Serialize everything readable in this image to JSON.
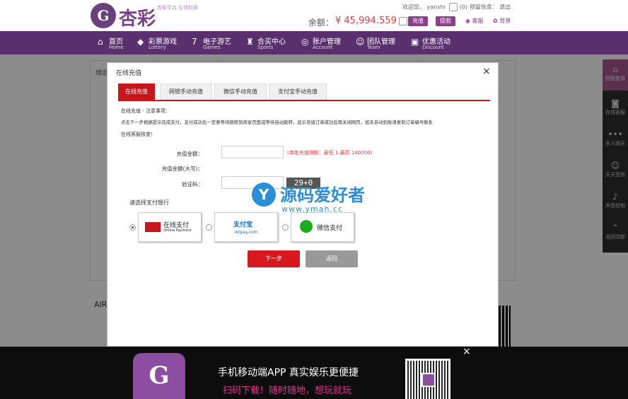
{
  "header": {
    "logo_letter": "G",
    "logo_text": "杏彩",
    "slogan": "杏彩平台 引领时尚",
    "welcome": "欢迎您，",
    "username": "yanshi",
    "msg_count": "(0)",
    "notice_label": "预留信息：",
    "logout": "退出",
    "balance_label": "余额：",
    "balance": "¥ 45,994.559",
    "recharge_btn": "充值",
    "withdraw_btn": "提款",
    "service_link": "客服",
    "skin_link": "背景"
  },
  "nav": [
    {
      "zh": "首页",
      "en": "Home",
      "icon": "home-icon"
    },
    {
      "zh": "彩票游戏",
      "en": "Lottery",
      "icon": "lottery-icon"
    },
    {
      "zh": "电子游艺",
      "en": "Games",
      "icon": "games-icon"
    },
    {
      "zh": "合买中心",
      "en": "Sports",
      "icon": "trophy-icon"
    },
    {
      "zh": "账户管理",
      "en": "Account",
      "icon": "account-icon"
    },
    {
      "zh": "团队管理",
      "en": "Team",
      "icon": "team-icon"
    },
    {
      "zh": "优惠活动",
      "en": "Discount",
      "icon": "gift-icon"
    }
  ],
  "background": {
    "tab_text": "绑定",
    "footer_text": "AIR"
  },
  "right_sidebar": [
    "回到首页",
    "在线客服",
    "多人聊天",
    "天天签到",
    "声音控制",
    "返回顶部"
  ],
  "modal": {
    "title": "在线充值",
    "close": "×",
    "tabs": [
      "在线充值",
      "网银手动充值",
      "微信手动充值",
      "支付宝手动充值"
    ],
    "notice_title": "在线充值 - 注意事项：",
    "notice_line1": "点击下一步根据提示完成支付，支付成功后一定要等待跳转到商家页面或等待自动跳转，显示充值订单成功后再关闭网页，如未自动到账请复制订单编号联系",
    "notice_line2": "在线客服核查！",
    "amount_label": "充值金额：",
    "amount_upper_label": "充值金额(大写)：",
    "captcha_label": "验证码：",
    "amount_hint": "(单笔充值限额：最低 1,最高 100000)",
    "captcha_value": "29+0",
    "bank_select_label": "请选择支付银行",
    "banks": [
      {
        "name": "在线支付",
        "sub": "Online Payment",
        "selected": true
      },
      {
        "name": "支付宝",
        "sub": "Alipay.com",
        "selected": false
      },
      {
        "name": "微信支付",
        "sub": "",
        "selected": false
      }
    ],
    "next_btn": "下一步",
    "back_btn": "返回"
  },
  "watermark": {
    "letter": "Y",
    "title": "源码爱好者",
    "url": "www.ymah.cc"
  },
  "banner": {
    "line1": "手机移动端APP 真实娱乐更便捷",
    "line2": "扫码下载！随时随地，想玩就玩",
    "close": "×"
  },
  "colors": {
    "nav_bg": "#5a2f6e",
    "accent_red": "#c8161d",
    "brand_purple": "#8b4ea0",
    "watermark_blue": "#2a8fd6"
  }
}
